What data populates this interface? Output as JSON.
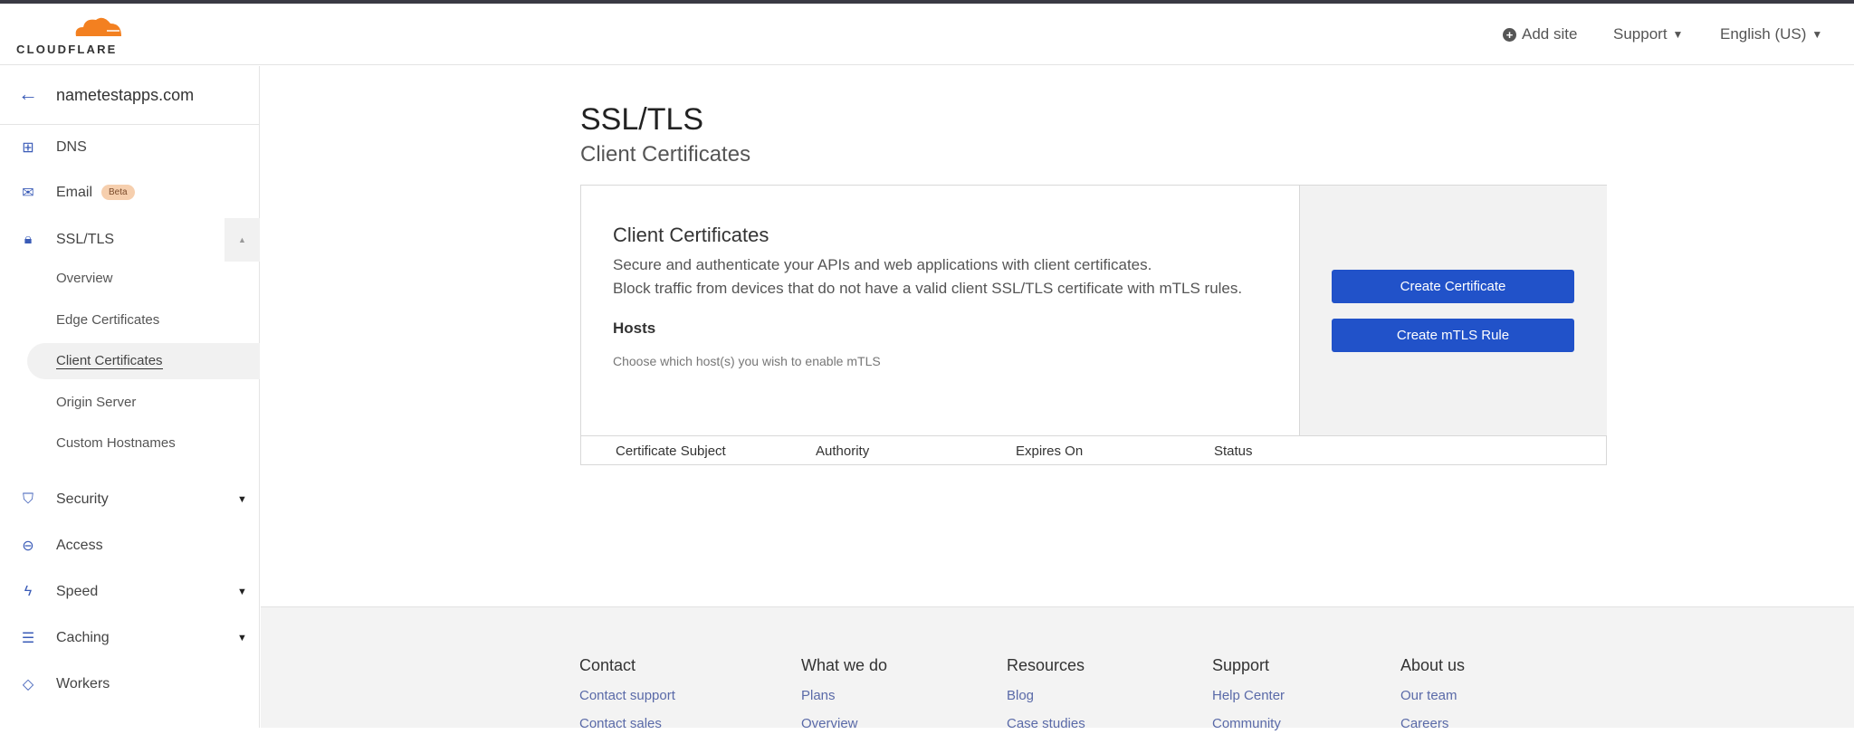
{
  "header": {
    "logo": "CLOUDFLARE",
    "add_site": "Add site",
    "support": "Support",
    "language": "English (US)"
  },
  "sidebar": {
    "domain": "nametestapps.com",
    "items": [
      {
        "label": "DNS"
      },
      {
        "label": "Email",
        "badge": "Beta"
      },
      {
        "label": "SSL/TLS"
      },
      {
        "label": "Security"
      },
      {
        "label": "Access"
      },
      {
        "label": "Speed"
      },
      {
        "label": "Caching"
      },
      {
        "label": "Workers"
      }
    ],
    "ssl_sub": [
      "Overview",
      "Edge Certificates",
      "Client Certificates",
      "Origin Server",
      "Custom Hostnames"
    ]
  },
  "page": {
    "title": "SSL/TLS",
    "subtitle": "Client Certificates"
  },
  "card": {
    "title": "Client Certificates",
    "desc1": "Secure and authenticate your APIs and web applications with client certificates.",
    "desc2": "Block traffic from devices that do not have a valid client SSL/TLS certificate with mTLS rules.",
    "hosts_title": "Hosts",
    "hosts_hint": "Choose which host(s) you wish to enable mTLS",
    "create_certificate": "Create Certificate",
    "create_mtls_rule": "Create mTLS Rule",
    "columns": [
      "Certificate Subject",
      "Authority",
      "Expires On",
      "Status"
    ]
  },
  "footer": {
    "columns": [
      {
        "title": "Contact",
        "links": [
          "Contact support",
          "Contact sales"
        ]
      },
      {
        "title": "What we do",
        "links": [
          "Plans",
          "Overview"
        ]
      },
      {
        "title": "Resources",
        "links": [
          "Blog",
          "Case studies"
        ]
      },
      {
        "title": "Support",
        "links": [
          "Help Center",
          "Community"
        ]
      },
      {
        "title": "About us",
        "links": [
          "Our team",
          "Careers"
        ]
      }
    ]
  },
  "colors": {
    "accent": "#2152c9",
    "brand_orange": "#f38020"
  }
}
